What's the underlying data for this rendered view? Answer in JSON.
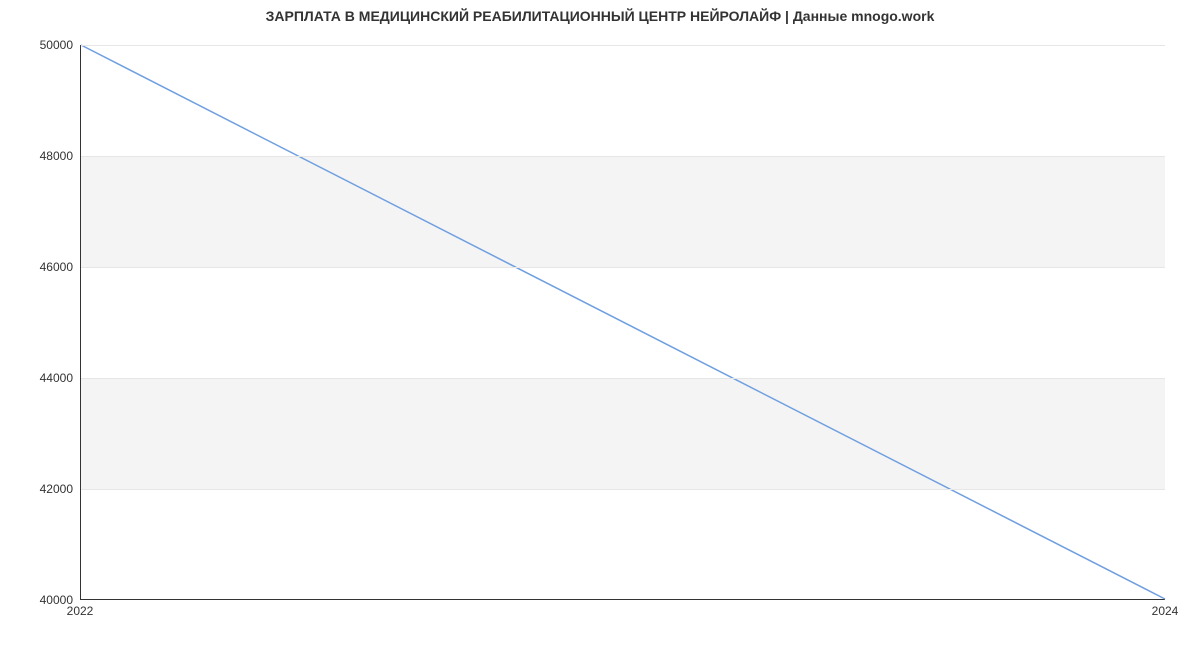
{
  "chart_data": {
    "type": "line",
    "title": "ЗАРПЛАТА В  МЕДИЦИНСКИЙ РЕАБИЛИТАЦИОННЫЙ ЦЕНТР НЕЙРОЛАЙФ | Данные mnogo.work",
    "xlabel": "",
    "ylabel": "",
    "x": [
      2022,
      2024
    ],
    "values": [
      50000,
      40000
    ],
    "xlim": [
      2022,
      2024
    ],
    "ylim": [
      40000,
      50000
    ],
    "x_ticks": [
      2022,
      2024
    ],
    "y_ticks": [
      40000,
      42000,
      44000,
      46000,
      48000,
      50000
    ],
    "zebra_bands": [
      [
        42000,
        44000
      ],
      [
        46000,
        48000
      ]
    ],
    "line_color": "#6f9fe0",
    "line_width": 1.5
  }
}
